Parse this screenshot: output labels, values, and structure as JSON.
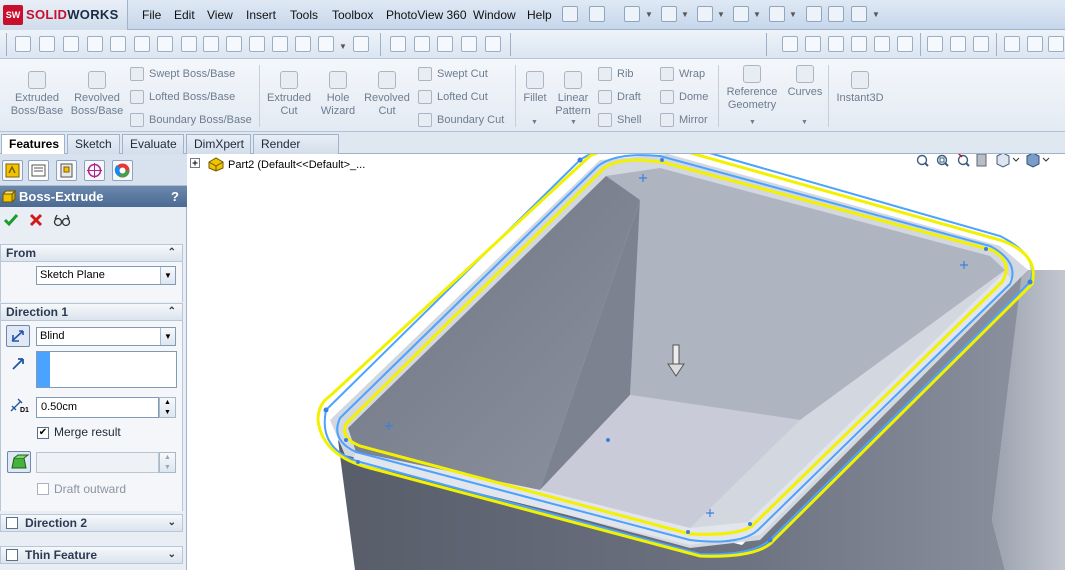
{
  "app": {
    "logo_mark": "SW",
    "logo_solid": "SOLID",
    "logo_works": "WORKS"
  },
  "menubar": {
    "items": [
      "File",
      "Edit",
      "View",
      "Insert",
      "Tools",
      "Toolbox",
      "PhotoView 360",
      "Window",
      "Help"
    ]
  },
  "ribbon": {
    "extruded_boss": "Extruded",
    "extruded_boss2": "Boss/Base",
    "revolved_boss": "Revolved",
    "revolved_boss2": "Boss/Base",
    "swept_boss": "Swept Boss/Base",
    "lofted_boss": "Lofted Boss/Base",
    "boundary_boss": "Boundary Boss/Base",
    "extruded_cut": "Extruded",
    "extruded_cut2": "Cut",
    "hole_wizard": "Hole",
    "hole_wizard2": "Wizard",
    "revolved_cut": "Revolved",
    "revolved_cut2": "Cut",
    "swept_cut": "Swept Cut",
    "lofted_cut": "Lofted Cut",
    "boundary_cut": "Boundary Cut",
    "fillet": "Fillet",
    "linear_pattern": "Linear",
    "linear_pattern2": "Pattern",
    "rib": "Rib",
    "draft": "Draft",
    "shell": "Shell",
    "wrap": "Wrap",
    "dome": "Dome",
    "mirror": "Mirror",
    "reference_geometry": "Reference",
    "reference_geometry2": "Geometry",
    "curves": "Curves",
    "instant3d": "Instant3D"
  },
  "tabs": [
    "Features",
    "Sketch",
    "Evaluate",
    "DimXpert",
    "Render Tools"
  ],
  "active_tab": "Features",
  "feature_tree": {
    "part_label": "Part2  (Default<<Default>_..."
  },
  "property_manager": {
    "title": "Boss-Extrude",
    "help": "?",
    "from": {
      "header": "From",
      "value": "Sketch Plane"
    },
    "direction1": {
      "header": "Direction 1",
      "end_condition": "Blind",
      "depth": "0.50cm",
      "merge_result_label": "Merge result",
      "merge_result_checked": true,
      "draft_outward_label": "Draft outward",
      "draft_outward_checked": false
    },
    "direction2": {
      "header": "Direction 2",
      "checked": false
    },
    "thin_feature": {
      "header": "Thin Feature",
      "checked": false
    },
    "depth_unit_mark": "D1"
  },
  "colors": {
    "accent_blue": "#4b6a93",
    "selection_yellow": "#f2f200",
    "preview_blue": "#4aa3ff",
    "model_gray": "#7b8291"
  },
  "icons": [
    "ok-check-icon",
    "cancel-x-icon",
    "detailed-preview-icon",
    "zoom-to-fit-icon",
    "zoom-area-icon",
    "previous-view-icon",
    "section-view-icon",
    "view-orientation-icon",
    "display-style-icon"
  ]
}
